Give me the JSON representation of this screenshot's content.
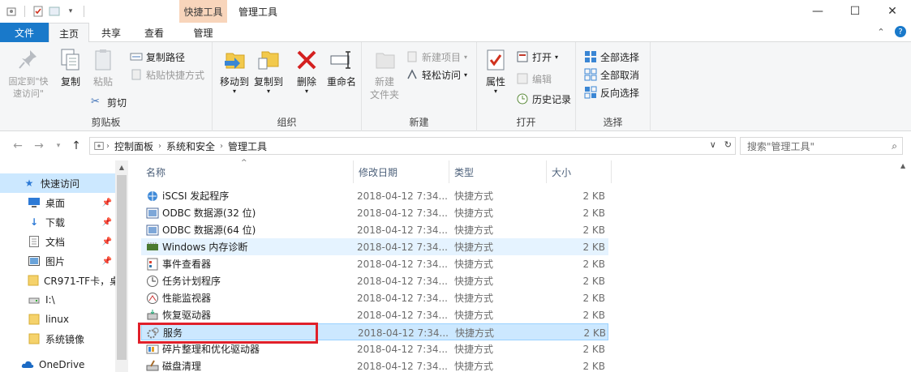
{
  "window": {
    "title": "管理工具",
    "context_tab_header": "快捷工具",
    "controls": [
      "—",
      "☐",
      "✕"
    ]
  },
  "ribbon_tabs": {
    "file": "文件",
    "home": "主页",
    "share": "共享",
    "view": "查看",
    "manage": "管理"
  },
  "ribbon": {
    "clipboard": {
      "label": "剪贴板",
      "pin_quick_access": "固定到\"快速访问\"",
      "copy": "复制",
      "paste": "粘贴",
      "copy_path": "复制路径",
      "paste_shortcut": "粘贴快捷方式",
      "cut": "剪切"
    },
    "organize": {
      "label": "组织",
      "move_to": "移动到",
      "copy_to": "复制到",
      "delete": "删除",
      "rename": "重命名"
    },
    "new": {
      "label": "新建",
      "new_folder": "新建\n文件夹",
      "new_item": "新建项目",
      "easy_access": "轻松访问"
    },
    "open": {
      "label": "打开",
      "properties": "属性",
      "open": "打开",
      "edit": "编辑",
      "history": "历史记录"
    },
    "select": {
      "label": "选择",
      "select_all": "全部选择",
      "select_none": "全部取消",
      "invert": "反向选择"
    }
  },
  "address": {
    "crumbs": [
      "控制面板",
      "系统和安全",
      "管理工具"
    ],
    "search_placeholder": "搜索\"管理工具\""
  },
  "navpane": {
    "items": [
      {
        "label": "快速访问",
        "icon": "star-icon",
        "pinned": false,
        "selected": true
      },
      {
        "label": "桌面",
        "icon": "desktop-icon",
        "pinned": true
      },
      {
        "label": "下载",
        "icon": "download-icon",
        "pinned": true
      },
      {
        "label": "文档",
        "icon": "document-icon",
        "pinned": true
      },
      {
        "label": "图片",
        "icon": "pictures-icon",
        "pinned": true
      },
      {
        "label": "CR971-TF卡，桌",
        "icon": "folder-icon",
        "pinned": false
      },
      {
        "label": "I:\\",
        "icon": "drive-icon",
        "pinned": false
      },
      {
        "label": "linux",
        "icon": "folder-icon",
        "pinned": false
      },
      {
        "label": "系统镜像",
        "icon": "folder-icon",
        "pinned": false
      },
      {
        "label": "OneDrive",
        "icon": "cloud-icon",
        "pinned": false
      }
    ]
  },
  "file_list": {
    "columns": [
      "名称",
      "修改日期",
      "类型",
      "大小"
    ],
    "rows": [
      {
        "name": "iSCSI 发起程序",
        "date": "2018-04-12 7:34...",
        "type": "快捷方式",
        "size": "2 KB",
        "icon": "iscsi-icon"
      },
      {
        "name": "ODBC 数据源(32 位)",
        "date": "2018-04-12 7:34...",
        "type": "快捷方式",
        "size": "2 KB",
        "icon": "odbc-icon"
      },
      {
        "name": "ODBC 数据源(64 位)",
        "date": "2018-04-12 7:34...",
        "type": "快捷方式",
        "size": "2 KB",
        "icon": "odbc-icon"
      },
      {
        "name": "Windows 内存诊断",
        "date": "2018-04-12 7:34...",
        "type": "快捷方式",
        "size": "2 KB",
        "icon": "memory-diagnostic-icon",
        "state": "hover"
      },
      {
        "name": "事件查看器",
        "date": "2018-04-12 7:34...",
        "type": "快捷方式",
        "size": "2 KB",
        "icon": "event-viewer-icon"
      },
      {
        "name": "任务计划程序",
        "date": "2018-04-12 7:34...",
        "type": "快捷方式",
        "size": "2 KB",
        "icon": "task-scheduler-icon"
      },
      {
        "name": "性能监视器",
        "date": "2018-04-12 7:34...",
        "type": "快捷方式",
        "size": "2 KB",
        "icon": "performance-monitor-icon"
      },
      {
        "name": "恢复驱动器",
        "date": "2018-04-12 7:34...",
        "type": "快捷方式",
        "size": "2 KB",
        "icon": "recovery-drive-icon"
      },
      {
        "name": "服务",
        "date": "2018-04-12 7:34...",
        "type": "快捷方式",
        "size": "2 KB",
        "icon": "services-icon",
        "state": "selected"
      },
      {
        "name": "碎片整理和优化驱动器",
        "date": "2018-04-12 7:34...",
        "type": "快捷方式",
        "size": "2 KB",
        "icon": "defrag-icon"
      },
      {
        "name": "磁盘清理",
        "date": "2018-04-12 7:34...",
        "type": "快捷方式",
        "size": "2 KB",
        "icon": "disk-cleanup-icon"
      }
    ]
  },
  "colors": {
    "accent": "#1979ca",
    "selection": "#cce8ff",
    "hover": "#e5f3ff",
    "highlight_box": "#e0202a",
    "context_tab": "#f8d5bb"
  }
}
